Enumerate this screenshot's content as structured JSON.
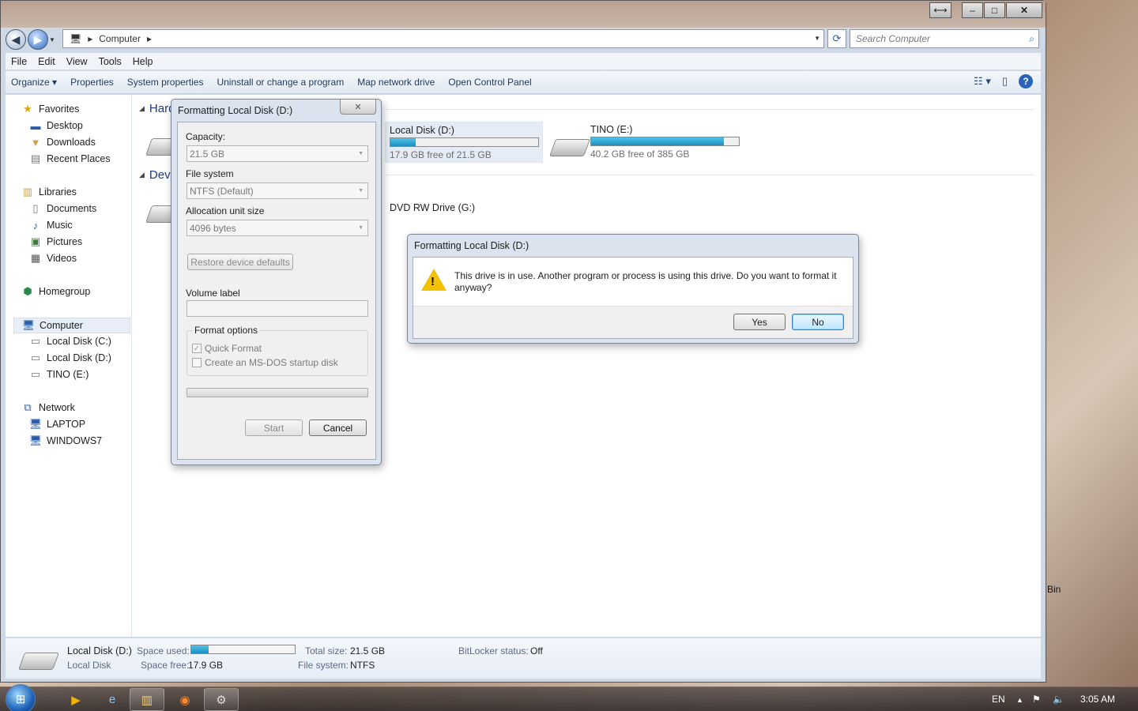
{
  "window": {
    "address": "Computer",
    "search_placeholder": "Search Computer",
    "menu": [
      "File",
      "Edit",
      "View",
      "Tools",
      "Help"
    ],
    "commands": [
      "Organize",
      "Properties",
      "System properties",
      "Uninstall or change a program",
      "Map network drive",
      "Open Control Panel"
    ]
  },
  "sidebar": {
    "favorites": "Favorites",
    "fav_items": [
      "Desktop",
      "Downloads",
      "Recent Places"
    ],
    "libraries": "Libraries",
    "lib_items": [
      "Documents",
      "Music",
      "Pictures",
      "Videos"
    ],
    "homegroup": "Homegroup",
    "computer": "Computer",
    "computer_items": [
      "Local Disk (C:)",
      "Local Disk (D:)",
      "TINO (E:)"
    ],
    "network": "Network",
    "network_items": [
      "LAPTOP",
      "WINDOWS7"
    ]
  },
  "main": {
    "group_hard": "Hard",
    "group_dev": "Devi",
    "drives": [
      {
        "name": "Local Disk (D:)",
        "free": "17.9 GB free of 21.5 GB",
        "used_fraction": 0.17
      },
      {
        "name": "TINO (E:)",
        "free": "40.2 GB free of 385 GB",
        "used_fraction": 0.9
      }
    ],
    "dvd": "DVD RW Drive (G:)"
  },
  "details": {
    "name": "Local Disk (D:)",
    "type": "Local Disk",
    "space_used_label": "Space used:",
    "space_free_label": "Space free:",
    "space_free": "17.9 GB",
    "total_label": "Total size:",
    "total": "21.5 GB",
    "fs_label": "File system:",
    "fs": "NTFS",
    "bitlocker_label": "BitLocker status:",
    "bitlocker": "Off",
    "used_fraction": 0.17
  },
  "format_dialog": {
    "title": "Formatting Local Disk (D:)",
    "capacity_label": "Capacity:",
    "capacity": "21.5 GB",
    "fs_label": "File system",
    "fs": "NTFS (Default)",
    "alloc_label": "Allocation unit size",
    "alloc": "4096 bytes",
    "restore": "Restore device defaults",
    "volume_label": "Volume label",
    "options_title": "Format options",
    "quick": "Quick Format",
    "msdos": "Create an MS-DOS startup disk",
    "start": "Start",
    "cancel": "Cancel"
  },
  "confirm": {
    "title": "Formatting Local Disk (D:)",
    "message": "This drive is in use. Another program or process is using this drive. Do you want to format it anyway?",
    "yes": "Yes",
    "no": "No"
  },
  "desktop": {
    "recycle": "Bin"
  },
  "taskbar": {
    "lang": "EN",
    "time": "3:05 AM"
  }
}
